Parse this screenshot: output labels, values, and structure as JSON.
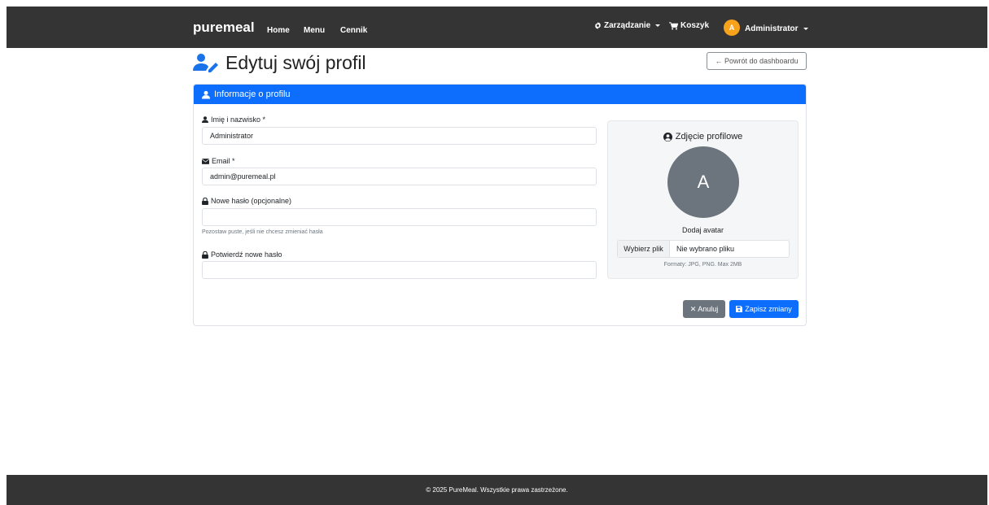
{
  "navbar": {
    "brand": "puremeal",
    "links": [
      "Home",
      "Menu",
      "Cennik"
    ],
    "management": "Zarządzanie",
    "cart": "Koszyk",
    "user_initial": "A",
    "user_name": "Administrator",
    "icons": {
      "management": "gear-icon",
      "cart": "cart-icon"
    }
  },
  "page": {
    "title": "Edytuj swój profil",
    "back_button": "← Powrót do dashboardu"
  },
  "card": {
    "header": "Informacje o profilu",
    "fields": {
      "name_label": "Imię i nazwisko *",
      "name_value": "Administrator",
      "email_label": "Email *",
      "email_value": "admin@puremeal.pl",
      "password_label": "Nowe hasło (opcjonalne)",
      "password_value": "",
      "password_hint": "Pozostaw puste, jeśli nie chcesz zmieniać hasła",
      "confirm_label": "Potwierdź nowe hasło",
      "confirm_value": ""
    },
    "avatar": {
      "title": "Zdjęcie profilowe",
      "initial": "A",
      "add_label": "Dodaj avatar",
      "choose_file": "Wybierz plik",
      "no_file": "Nie wybrano pliku",
      "formats": "Formaty: JPG, PNG. Max 2MB"
    },
    "buttons": {
      "cancel": "Anuluj",
      "save": "Zapisz zmiany"
    }
  },
  "footer": "© 2025 PureMeal. Wszystkie prawa zastrzeżone.",
  "colors": {
    "navbar": "#343434",
    "primary": "#0d6efd",
    "secondary": "#6c757d",
    "user_badge": "#f7a21b"
  }
}
